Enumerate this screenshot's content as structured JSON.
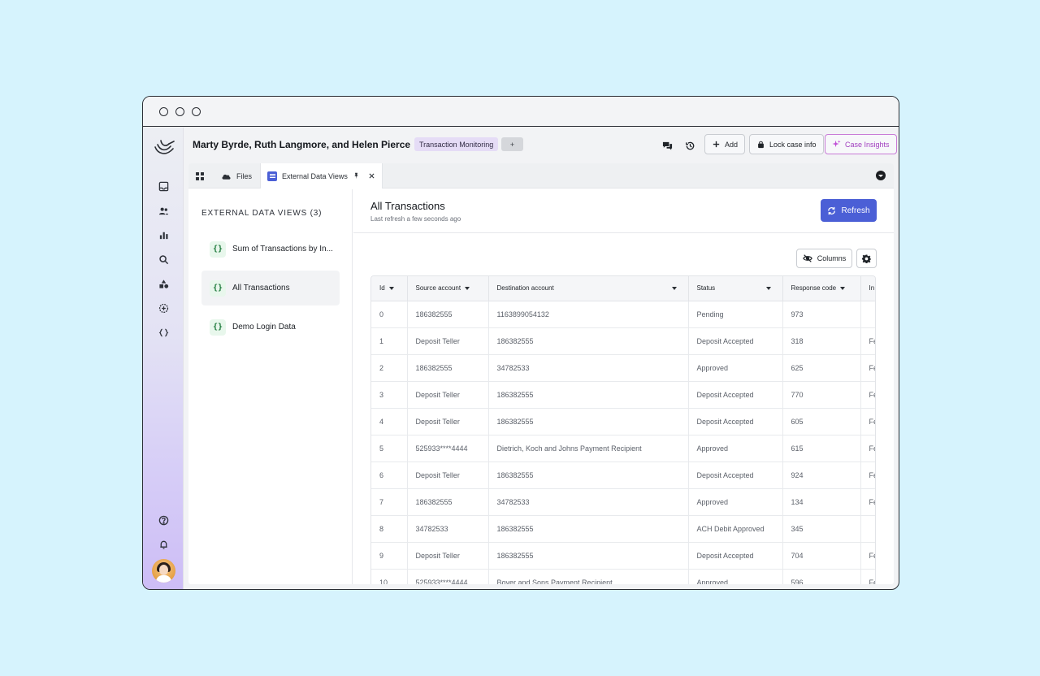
{
  "header": {
    "case_title": "Marty Byrde, Ruth Langmore, and Helen Pierce",
    "tags": [
      "Transaction Monitoring",
      "+"
    ],
    "add_label": "Add",
    "lock_label": "Lock case info",
    "insights_label": "Case Insights"
  },
  "tabs": {
    "files_label": "Files",
    "external_label": "External Data Views"
  },
  "left_panel": {
    "heading": "EXTERNAL DATA VIEWS (3)",
    "icon_glyph": "{}",
    "items": [
      "Sum of Transactions by In...",
      "All Transactions",
      "Demo Login Data"
    ]
  },
  "main": {
    "title": "All Transactions",
    "subtitle": "Last refresh a few seconds ago",
    "refresh_label": "Refresh",
    "columns_label": "Columns"
  },
  "table": {
    "columns": [
      "Id",
      "Source account",
      "Destination account",
      "Status",
      "Response code",
      "In"
    ],
    "rows": [
      [
        "0",
        "186382555",
        "1163899054132",
        "Pending",
        "973",
        ""
      ],
      [
        "1",
        "Deposit Teller",
        "186382555",
        "Deposit Accepted",
        "318",
        "Fe"
      ],
      [
        "2",
        "186382555",
        "34782533",
        "Approved",
        "625",
        "Fe"
      ],
      [
        "3",
        "Deposit Teller",
        "186382555",
        "Deposit Accepted",
        "770",
        "Fe"
      ],
      [
        "4",
        "Deposit Teller",
        "186382555",
        "Deposit Accepted",
        "605",
        "Fe"
      ],
      [
        "5",
        "525933****4444",
        "Dietrich, Koch and Johns Payment Recipient",
        "Approved",
        "615",
        "Fe"
      ],
      [
        "6",
        "Deposit Teller",
        "186382555",
        "Deposit Accepted",
        "924",
        "Fe"
      ],
      [
        "7",
        "186382555",
        "34782533",
        "Approved",
        "134",
        "Fe"
      ],
      [
        "8",
        "34782533",
        "186382555",
        "ACH Debit Approved",
        "345",
        ""
      ],
      [
        "9",
        "Deposit Teller",
        "186382555",
        "Deposit Accepted",
        "704",
        "Fe"
      ],
      [
        "10",
        "525933****4444",
        "Boyer and Sons Payment Recipient",
        "Approved",
        "596",
        "Fe"
      ]
    ]
  },
  "colors": {
    "accent": "#4b5fd6",
    "insights": "#a13fbf",
    "tag_bg": "#e5dcf6"
  }
}
